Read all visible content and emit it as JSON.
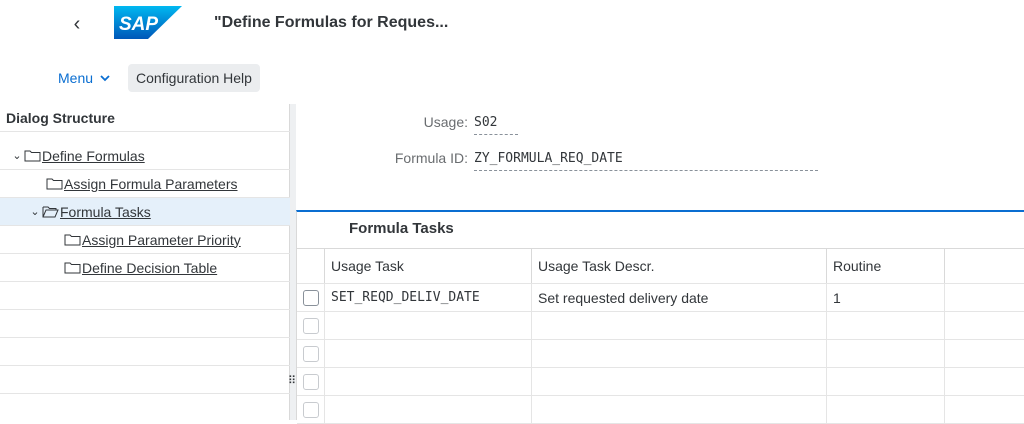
{
  "shell": {
    "back_glyph": "‹",
    "logo_text": "SAP",
    "title": "\"Define Formulas for Reques..."
  },
  "toolbar": {
    "menu_label": "Menu",
    "help_label": "Configuration Help"
  },
  "tree": {
    "header": "Dialog Structure",
    "items": [
      {
        "label": "Define Formulas",
        "chevron": "⌄"
      },
      {
        "label": "Assign Formula Parameters",
        "chevron": ""
      },
      {
        "label": "Formula Tasks",
        "chevron": "⌄",
        "selected": true
      },
      {
        "label": "Assign Parameter Priority",
        "chevron": ""
      },
      {
        "label": "Define Decision Table",
        "chevron": ""
      }
    ]
  },
  "fields": {
    "usage_label": "Usage:",
    "usage_value": "S02",
    "formula_id_label": "Formula ID:",
    "formula_id_value": "ZY_FORMULA_REQ_DATE"
  },
  "table": {
    "title": "Formula Tasks",
    "columns": [
      "Usage Task",
      "Usage Task Descr.",
      "Routine"
    ],
    "rows": [
      [
        "SET_REQD_DELIV_DATE",
        "Set requested delivery date",
        "1"
      ]
    ]
  },
  "colors": {
    "accent": "#0a6ed1",
    "selection": "#e5f0fa",
    "logo_blue": "#0a6ed1"
  }
}
